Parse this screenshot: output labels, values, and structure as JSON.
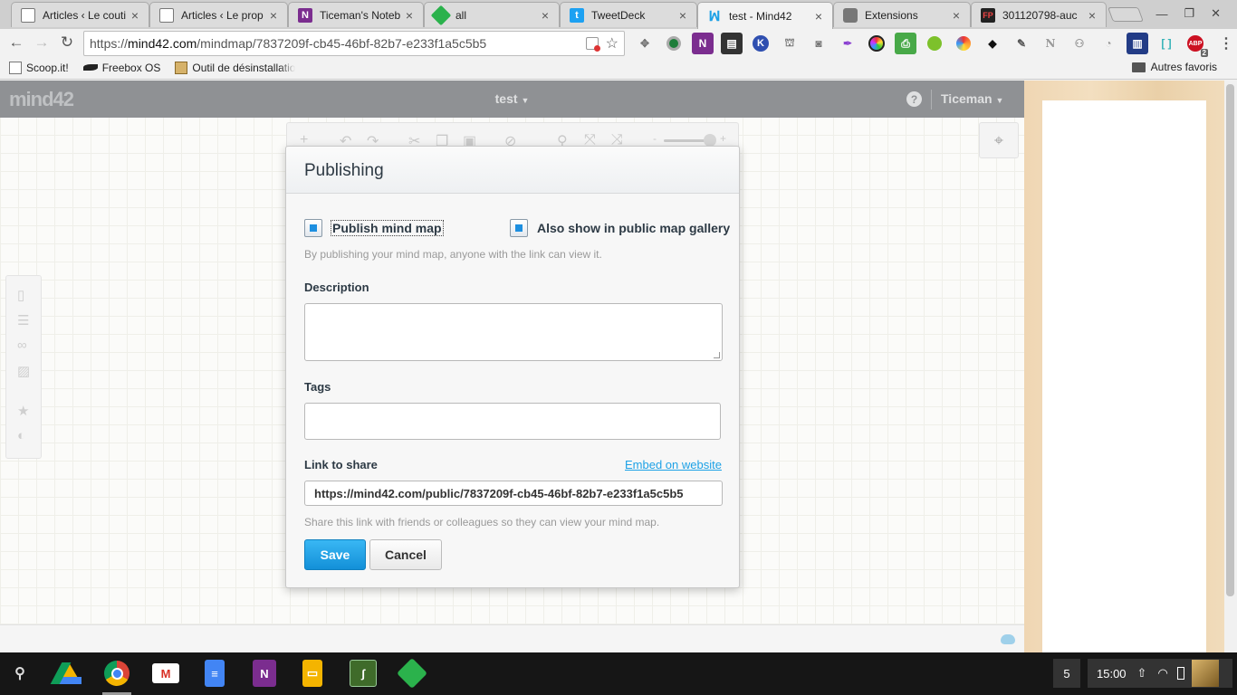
{
  "browser": {
    "tabs": [
      {
        "title": "Articles ‹ Le couti",
        "icon": "page-icon"
      },
      {
        "title": "Articles ‹ Le prop",
        "icon": "page-icon"
      },
      {
        "title": "Ticeman's Noteb",
        "icon": "onenote-icon"
      },
      {
        "title": "all",
        "icon": "feedly-icon"
      },
      {
        "title": "TweetDeck",
        "icon": "tweetdeck-icon"
      },
      {
        "title": "test - Mind42",
        "icon": "mind42-icon",
        "active": true
      },
      {
        "title": "Extensions",
        "icon": "puzzle-icon"
      },
      {
        "title": "301120798-auc",
        "icon": "fp-icon"
      }
    ],
    "url_prefix": "https://",
    "url_host": "mind42.com",
    "url_path": "/mindmap/7837209f-cb45-46bf-82b7-e233f1a5c5b5",
    "bookmarks": [
      {
        "label": "Scoop.it!",
        "icon": "scoopit-icon"
      },
      {
        "label": "Freebox OS",
        "icon": "freebox-icon"
      },
      {
        "label": "Outil de désinstallatio",
        "icon": "tool-icon"
      }
    ],
    "other_bookmarks": "Autres favoris",
    "extensions": [
      "puzzle-icon",
      "circle-icon",
      "onenote-icon",
      "film-icon",
      "k-icon",
      "chat-icon",
      "camera-icon",
      "quill-icon",
      "color-icon",
      "print-icon",
      "dot-icon",
      "colorzilla-icon",
      "fish-icon",
      "pencil-icon",
      "n-icon",
      "users-icon",
      "rss-icon",
      "book-icon",
      "bracket-icon",
      "abp-icon"
    ],
    "abp_badge": "2"
  },
  "app": {
    "logo": "mind42",
    "map_title": "test",
    "user": "Ticeman"
  },
  "dialog": {
    "title": "Publishing",
    "publish_label": "Publish mind map",
    "gallery_label": "Also show in public map gallery",
    "publish_hint": "By publishing your mind map, anyone with the link can view it.",
    "description_label": "Description",
    "description_value": "",
    "tags_label": "Tags",
    "tags_value": "",
    "link_label": "Link to share",
    "embed_label": "Embed on website",
    "link_value": "https://mind42.com/public/7837209f-cb45-46bf-82b7-e233f1a5c5b5",
    "link_hint": "Share this link with friends or colleagues so they can view your mind map.",
    "save_label": "Save",
    "cancel_label": "Cancel"
  },
  "taskbar": {
    "apps": [
      "search-icon",
      "drive-icon",
      "chrome-icon",
      "gmail-icon",
      "docs-icon",
      "onenote-icon",
      "slides-icon",
      "stylus-icon",
      "feedly-icon"
    ],
    "notification_count": "5",
    "time": "15:00"
  },
  "colors": {
    "accent": "#1da1e6",
    "save_button": "#1c9be5",
    "header": "#8f9194"
  }
}
